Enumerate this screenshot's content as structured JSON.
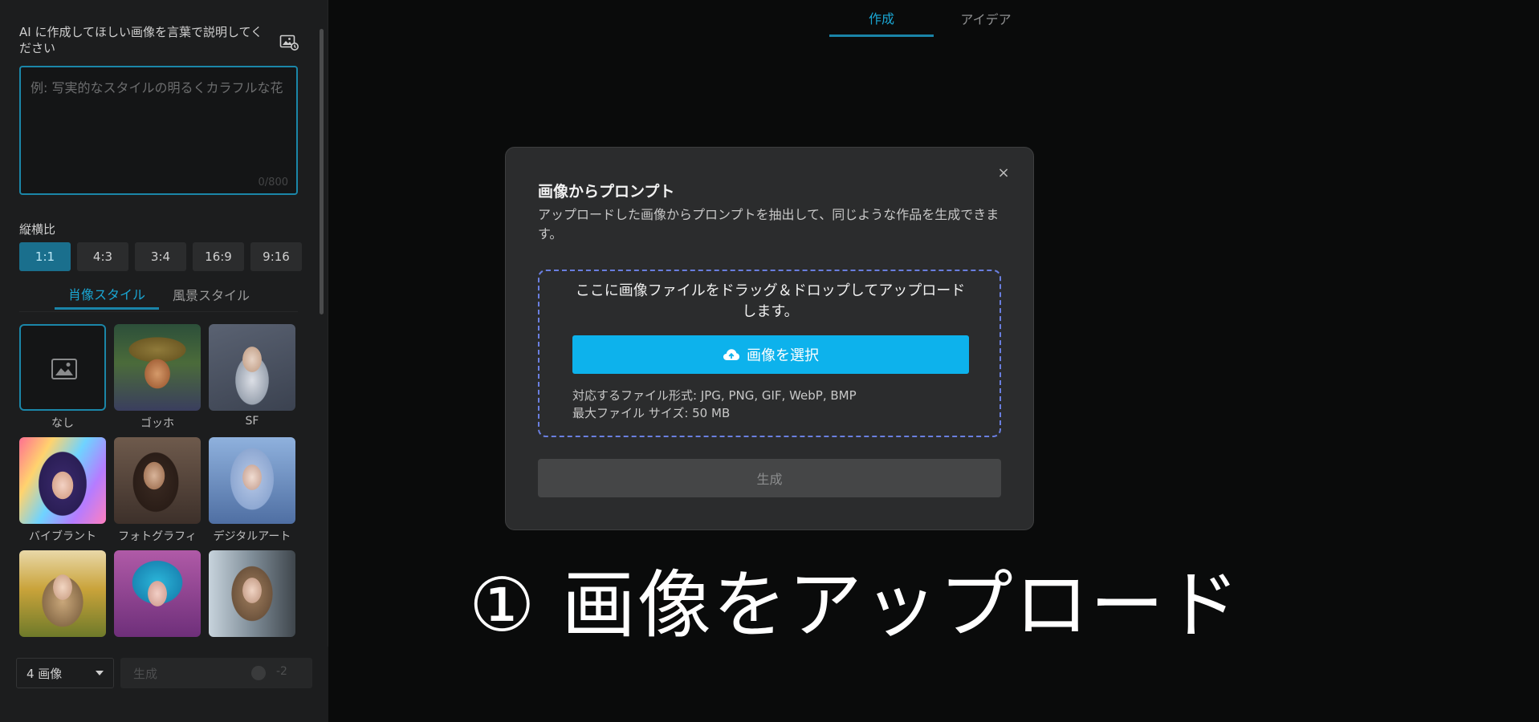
{
  "sidebar": {
    "prompt_heading": "AI に作成してほしい画像を言葉で説明してください",
    "prompt_placeholder": "例: 写実的なスタイルの明るくカラフルな花",
    "prompt_counter": "0/800",
    "ratio_label": "縦横比",
    "ratios": [
      "1:1",
      "4:3",
      "3:4",
      "16:9",
      "9:16"
    ],
    "ratio_selected": "1:1",
    "style_tabs": [
      "肖像スタイル",
      "風景スタイル"
    ],
    "styles": [
      {
        "name": "なし",
        "selected": true
      },
      {
        "name": "ゴッホ"
      },
      {
        "name": "SF"
      },
      {
        "name": "バイブラント"
      },
      {
        "name": "フォトグラフィ"
      },
      {
        "name": "デジタルアート"
      },
      {
        "name": ""
      },
      {
        "name": ""
      },
      {
        "name": ""
      }
    ],
    "image_count": "4 画像",
    "generate_label": "生成",
    "credit_cost": "-2"
  },
  "main": {
    "tabs": [
      "作成",
      "アイデア"
    ],
    "active_tab": "作成"
  },
  "modal": {
    "close_glyph": "×",
    "title": "画像からプロンプト",
    "description": "アップロードした画像からプロンプトを抽出して、同じような作品を生成できます。",
    "drop_text": "ここに画像ファイルをドラッグ＆ドロップしてアップロードします。",
    "select_button": "画像を選択",
    "formats_line": "対応するファイル形式: JPG, PNG, GIF, WebP, BMP",
    "max_size_line": "最大ファイル サイズ: 50 MB",
    "generate_button": "生成"
  },
  "caption": "① 画像をアップロード",
  "colors": {
    "accent": "#1aa6d3",
    "primary_button": "#0db2ec",
    "background": "#0a0b0b",
    "sidebar": "#1c1d1e",
    "modal": "#2b2c2d"
  }
}
